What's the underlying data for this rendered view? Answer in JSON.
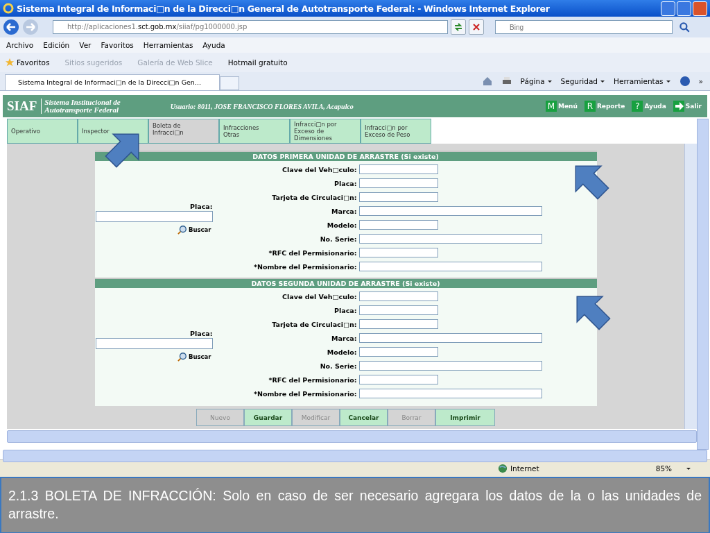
{
  "window": {
    "title": "Sistema Integral de Informaci□n de la Direcci□n General de Autotransporte Federal: - Windows Internet Explorer"
  },
  "address_bar": {
    "url_prefix": "http://aplicaciones1.",
    "url_domain": "sct.gob.mx",
    "url_path": "/siiaf/pg1000000.jsp",
    "search_placeholder": "Bing"
  },
  "menu": [
    "Archivo",
    "Edición",
    "Ver",
    "Favoritos",
    "Herramientas",
    "Ayuda"
  ],
  "favorites_bar": {
    "label": "Favoritos",
    "items": [
      {
        "label": "Sitios sugeridos",
        "dimmed": true
      },
      {
        "label": "Galería de Web Slice",
        "dimmed": true
      },
      {
        "label": "Hotmail gratuito",
        "dimmed": false
      }
    ]
  },
  "browser_tab": {
    "title": "Sistema Integral de Informaci□n de la Direcci□n Gen..."
  },
  "command_bar": {
    "menus": [
      "Página",
      "Seguridad",
      "Herramientas"
    ],
    "more": "»"
  },
  "app_header": {
    "logo": "SIAF",
    "subtitle": [
      "Sistema Institucional de",
      "Autotransporte Federal"
    ],
    "user": "Usuario: 8011, JOSE FRANCISCO FLORES AVILA, Acapulco",
    "actions": [
      {
        "kind": "letter",
        "badge": "M",
        "label": "Menú"
      },
      {
        "kind": "letter",
        "badge": "R",
        "label": "Reporte"
      },
      {
        "kind": "letter",
        "badge": "?",
        "label": "Ayuda"
      },
      {
        "kind": "arrow",
        "label": "Salir"
      }
    ]
  },
  "tabs": [
    {
      "label": "Operativo",
      "selected": false
    },
    {
      "label": "Inspector",
      "selected": false
    },
    {
      "label": "Boleta de Infracci□n",
      "selected": true
    },
    {
      "label": "Infracciones Otras",
      "selected": false
    },
    {
      "label": "Infracci□n por Exceso de Dimensiones",
      "selected": false
    },
    {
      "label": "Infracci□n por Exceso de Peso",
      "selected": false
    }
  ],
  "sections": [
    {
      "title": "DATOS PRIMERA UNIDAD DE ARRASTRE (Si existe)",
      "search_label": "Placa:",
      "search_button": "Buscar",
      "fields": [
        {
          "label": "Clave del Veh□culo:",
          "kind": "short"
        },
        {
          "label": "Placa:",
          "kind": "short"
        },
        {
          "label": "Tarjeta de Circulaci□n:",
          "kind": "short"
        },
        {
          "label": "Marca:",
          "kind": "long"
        },
        {
          "label": "Modelo:",
          "kind": "short"
        },
        {
          "label": "No. Serie:",
          "kind": "long"
        },
        {
          "label": "*RFC del Permisionario:",
          "kind": "short"
        },
        {
          "label": "*Nombre del Permisionario:",
          "kind": "long"
        }
      ]
    },
    {
      "title": "DATOS SEGUNDA UNIDAD DE ARRASTRE (Si existe)",
      "search_label": "Placa:",
      "search_button": "Buscar",
      "fields": [
        {
          "label": "Clave del Veh□culo:",
          "kind": "short"
        },
        {
          "label": "Placa:",
          "kind": "short"
        },
        {
          "label": "Tarjeta de Circulaci□n:",
          "kind": "short"
        },
        {
          "label": "Marca:",
          "kind": "long"
        },
        {
          "label": "Modelo:",
          "kind": "short"
        },
        {
          "label": "No. Serie:",
          "kind": "long"
        },
        {
          "label": "*RFC del Permisionario:",
          "kind": "short"
        },
        {
          "label": "*Nombre del Permisionario:",
          "kind": "long"
        }
      ]
    }
  ],
  "buttons": [
    {
      "label": "Nuevo",
      "disabled": true
    },
    {
      "label": "Guardar",
      "disabled": false
    },
    {
      "label": "Modificar",
      "disabled": true
    },
    {
      "label": "Cancelar",
      "disabled": false
    },
    {
      "label": "Borrar",
      "disabled": true
    },
    {
      "label": "Imprimir",
      "disabled": false
    }
  ],
  "status_bar": {
    "zone": "Internet",
    "zoom": "85%"
  },
  "caption": "2.1.3 BOLETA DE INFRACCIÓN: Solo en caso de ser necesario agregara los datos de  la o las unidades de arrastre."
}
